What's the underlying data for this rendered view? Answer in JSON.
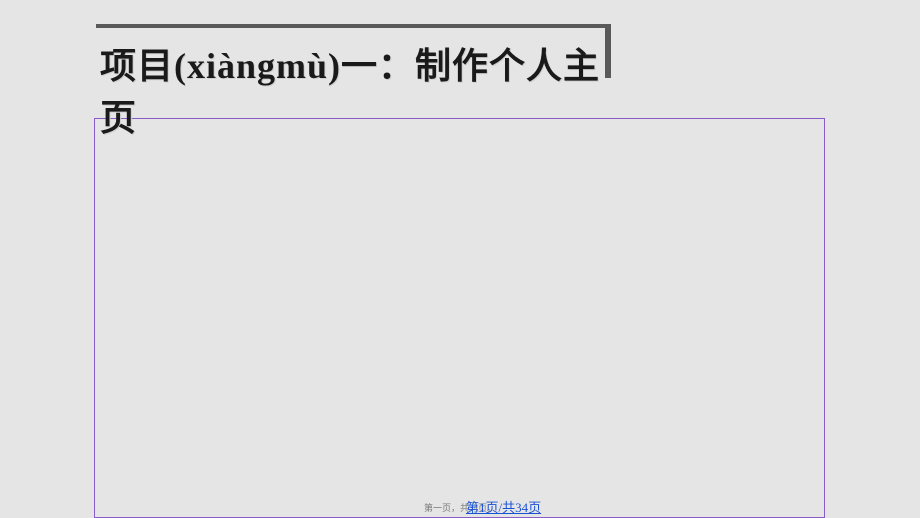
{
  "slide": {
    "title": "项目(xiàngmù)一：制作个人主页"
  },
  "footer": {
    "small_text": "第一页，共34页。",
    "page_link": "第1页/共34页"
  }
}
